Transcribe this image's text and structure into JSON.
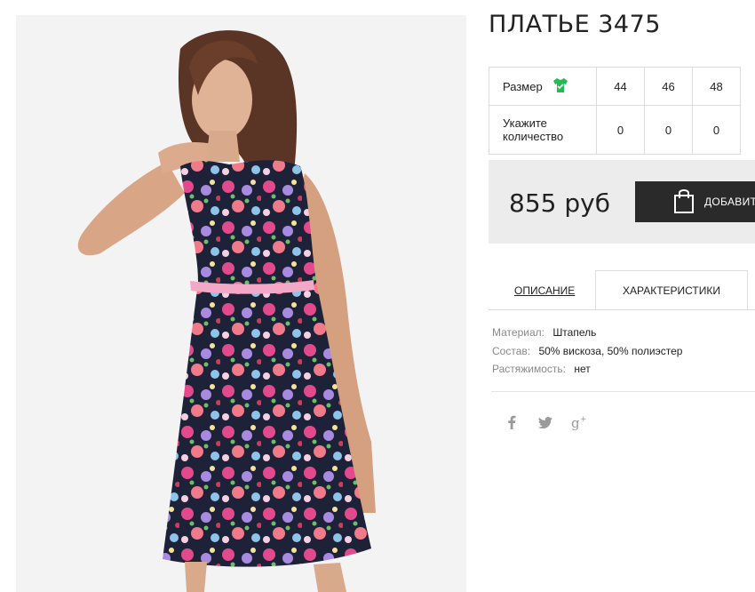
{
  "product": {
    "title": "ПЛАТЬЕ 3475"
  },
  "sizes": {
    "size_label": "Размер",
    "qty_label": "Укажите количество",
    "items": [
      {
        "size": "44",
        "qty": "0"
      },
      {
        "size": "46",
        "qty": "0"
      },
      {
        "size": "48",
        "qty": "0"
      }
    ]
  },
  "price": {
    "value": "855 руб",
    "add_label": "ДОБАВИТЬ"
  },
  "tabs": {
    "description": "ОПИСАНИЕ",
    "characteristics": "ХАРАКТЕРИСТИКИ"
  },
  "specs": [
    {
      "key": "Материал:",
      "value": "Штапель"
    },
    {
      "key": "Состав:",
      "value": "50% вискоза, 50% полиэстер"
    },
    {
      "key": "Растяжимость:",
      "value": "нет"
    }
  ],
  "social": [
    "facebook-icon",
    "twitter-icon",
    "google-plus-icon"
  ],
  "colors": {
    "add_button": "#2a2a2a",
    "price_bg": "#ececec",
    "size_icon": "#22bb55"
  }
}
